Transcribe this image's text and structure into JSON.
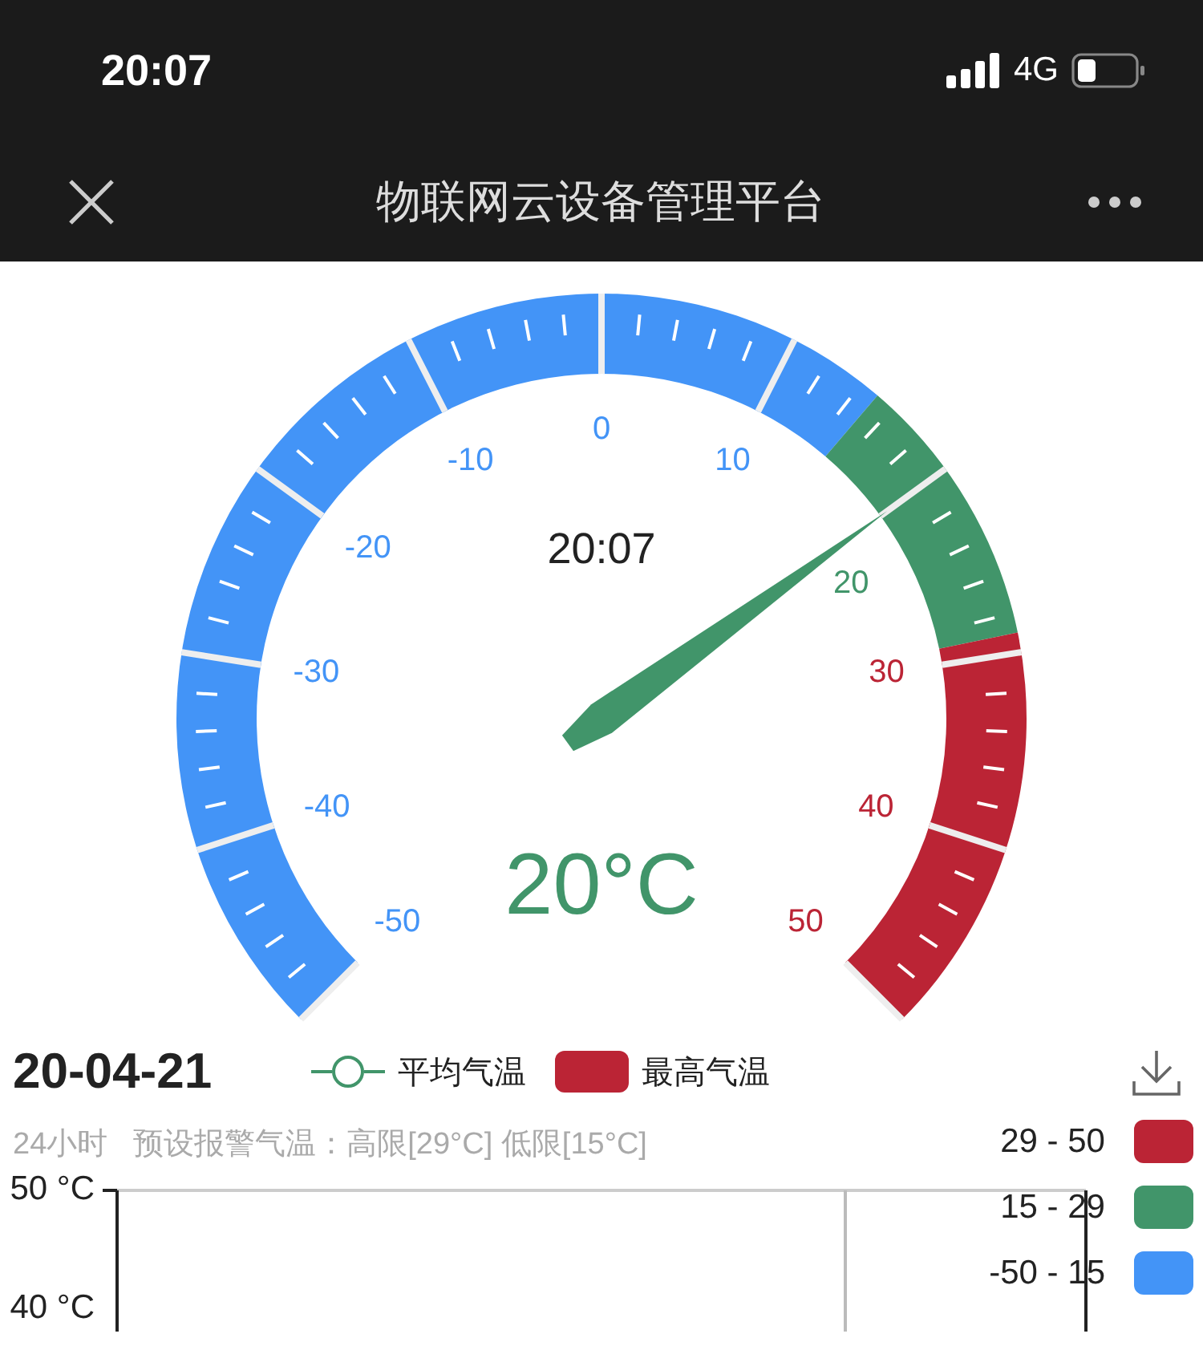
{
  "status_bar": {
    "time": "20:07",
    "network": "4G"
  },
  "nav": {
    "title": "物联网云设备管理平台"
  },
  "gauge": {
    "time": "20:07",
    "reading": "20°C",
    "bands": [
      {
        "color": "#4394f7"
      },
      {
        "color": "#41956a"
      },
      {
        "color": "#bb2435"
      }
    ],
    "scale": [
      "-50",
      "-40",
      "-30",
      "-20",
      "-10",
      "0",
      "10",
      "20",
      "30",
      "40",
      "50"
    ]
  },
  "date": "20-04-21",
  "legend": [
    {
      "label": "平均气温",
      "kind": "line",
      "color": "#41956a"
    },
    {
      "label": "最高气温",
      "kind": "box",
      "color": "#bb2435"
    }
  ],
  "subtitle": {
    "period": "24小时",
    "alarm": "预设报警气温：高限[29°C] 低限[15°C]"
  },
  "visual_map": [
    {
      "label": "29 - 50",
      "color": "#bb2435"
    },
    {
      "label": "15 - 29",
      "color": "#41956a"
    },
    {
      "label": "-50 - 15",
      "color": "#4394f7"
    }
  ],
  "chart": {
    "y_ticks": [
      "50 °C",
      "40 °C"
    ]
  }
}
